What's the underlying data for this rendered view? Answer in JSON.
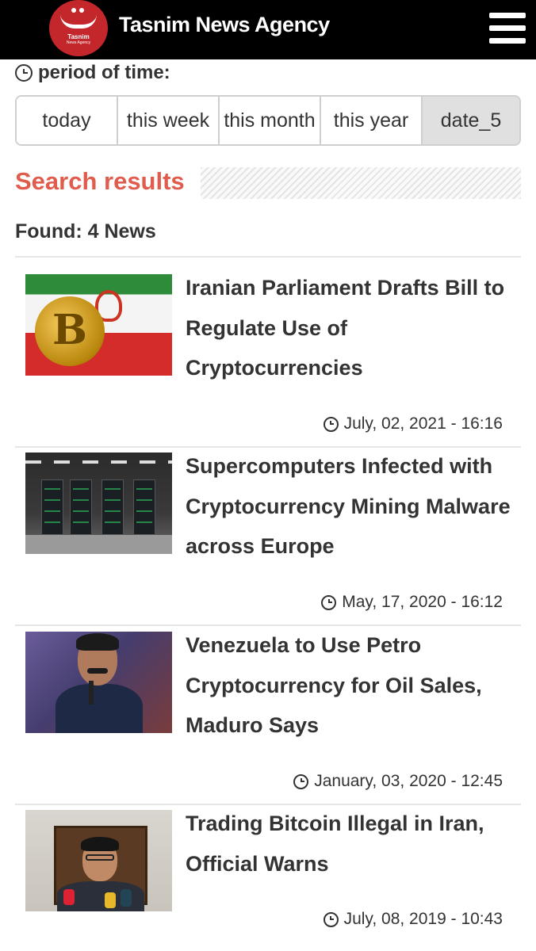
{
  "header": {
    "logo_text": "Tasnim",
    "logo_subtext": "News Agency",
    "brand": "Tasnim News Agency",
    "menu_icon": "hamburger-menu-icon"
  },
  "filters": {
    "label": "period of time:",
    "options": [
      "today",
      "this week",
      "this month",
      "this year",
      "date_5"
    ],
    "selected": "date_5"
  },
  "results": {
    "title": "Search results",
    "found": "Found: 4 News",
    "items": [
      {
        "title": "Iranian Parliament Drafts Bill to Regulate Use of Cryptocurrencies",
        "date": "July, 02, 2021 - 16:16",
        "thumb": "iran-flag-bitcoin"
      },
      {
        "title": "Supercomputers Infected with Cryptocurrency Mining Malware across Europe",
        "date": "May, 17, 2020 - 16:12",
        "thumb": "supercomputer-room"
      },
      {
        "title": "Venezuela to Use Petro Cryptocurrency for Oil Sales, Maduro Says",
        "date": "January, 03, 2020 - 12:45",
        "thumb": "maduro-portrait"
      },
      {
        "title": "Trading Bitcoin Illegal in Iran, Official Warns",
        "date": "July, 08, 2019 - 10:43",
        "thumb": "official-press-conference"
      }
    ]
  },
  "colors": {
    "accent": "#e05c4d",
    "topbar": "#000000",
    "logo": "#c3272b"
  }
}
